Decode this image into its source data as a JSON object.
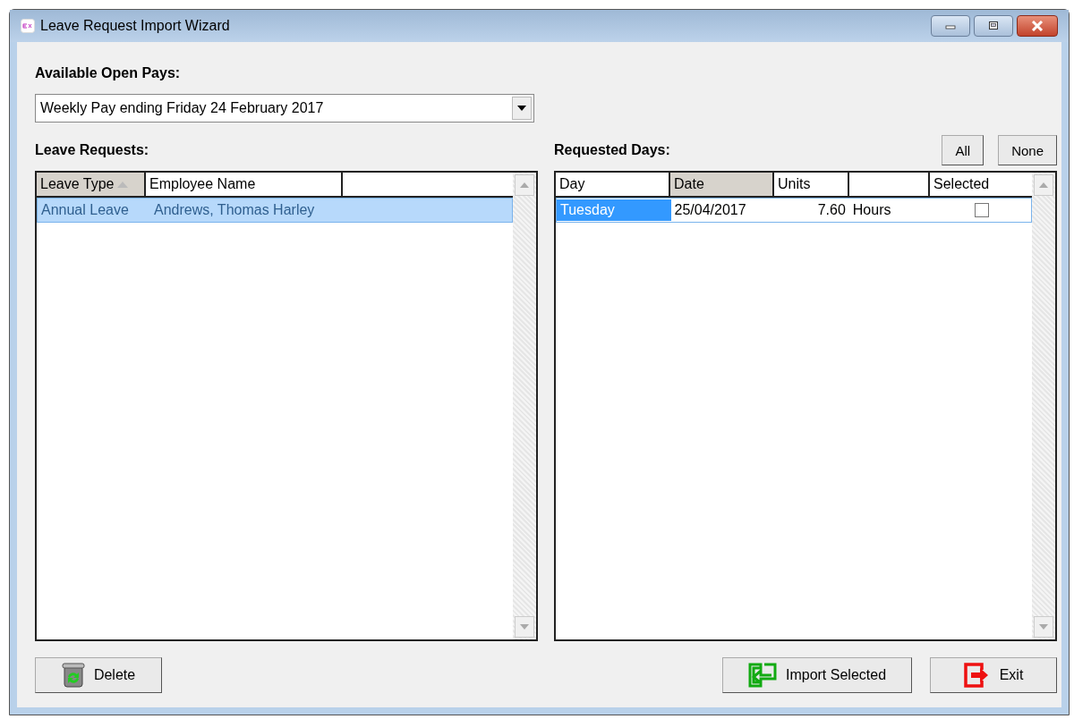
{
  "window": {
    "title": "Leave Request Import Wizard"
  },
  "open_pays": {
    "label": "Available Open Pays:",
    "value": "Weekly Pay ending Friday 24 February 2017"
  },
  "leave_requests": {
    "label": "Leave Requests:",
    "columns": [
      {
        "label": "Leave Type",
        "sorted": true
      },
      {
        "label": "Employee Name",
        "sorted": false
      }
    ],
    "rows": [
      {
        "leave_type": "Annual Leave",
        "employee_name": "Andrews, Thomas  Harley",
        "selected": true
      }
    ]
  },
  "requested_days": {
    "label": "Requested Days:",
    "buttons": [
      "All",
      "None"
    ],
    "columns": [
      {
        "label": "Day",
        "sorted": false
      },
      {
        "label": "Date",
        "sorted": true
      },
      {
        "label": "Units",
        "sorted": false
      },
      {
        "label": "Selected",
        "sorted": false
      }
    ],
    "rows": [
      {
        "day": "Tuesday",
        "date": "25/04/2017",
        "units": "7.60",
        "unit_name": "Hours",
        "checked": false,
        "selected": true
      }
    ]
  },
  "buttons": [
    {
      "kind": "delete",
      "label": "Delete"
    },
    {
      "kind": "import",
      "label": "Import Selected"
    },
    {
      "kind": "exit",
      "label": "Exit"
    }
  ]
}
